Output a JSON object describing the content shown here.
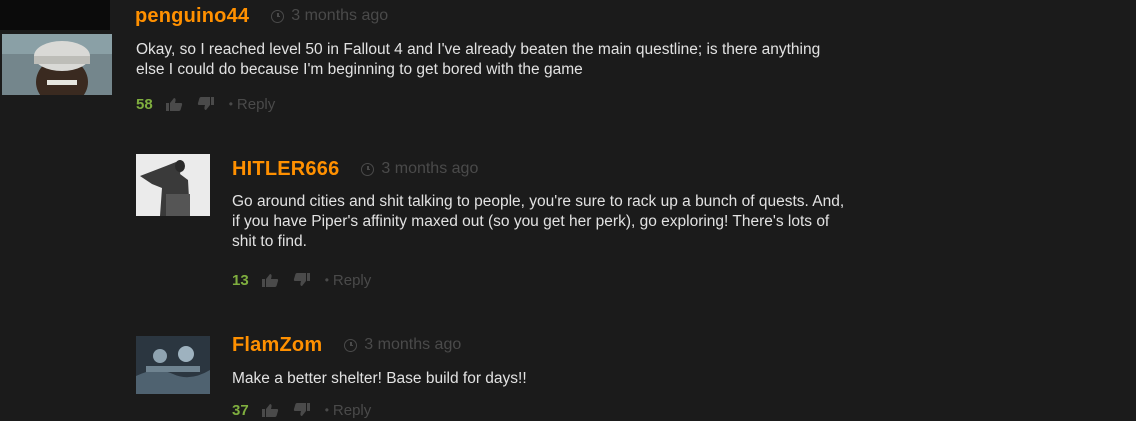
{
  "comments": [
    {
      "username": "penguino44",
      "time": "3 months ago",
      "lines": [
        "Okay, so I reached level 50 in Fallout 4 and I've already beaten the main questline; is there anything",
        "else I could do because I'm beginning to get bored with the game"
      ],
      "votes": "58",
      "reply_label": "Reply"
    },
    {
      "username": "HITLER666",
      "time": "3 months ago",
      "lines": [
        "Go around cities and shit talking to people, you're sure to rack up a bunch of quests. And,",
        "if you have Piper's affinity maxed out (so you get her perk), go exploring! There's lots of",
        "shit to find."
      ],
      "votes": "13",
      "reply_label": "Reply"
    },
    {
      "username": "FlamZom",
      "time": "3 months ago",
      "lines": [
        "Make a better shelter! Base build for days!!"
      ],
      "votes": "37",
      "reply_label": "Reply"
    }
  ],
  "icons": {
    "time": "clock-icon",
    "upvote": "thumbs-up-icon",
    "downvote": "thumbs-down-icon",
    "separator": "•"
  },
  "colors": {
    "background": "#1b1b1b",
    "username": "#ff9000",
    "votes": "#7fae3f",
    "muted": "#4a4a4a",
    "text": "#e2e2e2"
  }
}
